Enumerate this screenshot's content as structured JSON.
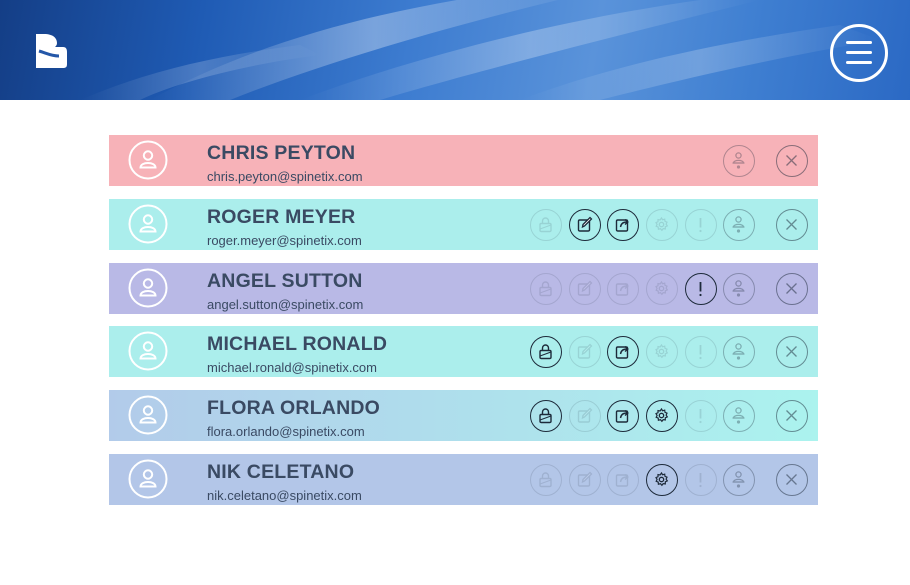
{
  "header": {
    "logo_icon": "company-logo",
    "menu_icon": "hamburger-menu-icon"
  },
  "users": [
    {
      "name": "CHRIS PEYTON",
      "email": "chris.peyton@spinetix.com",
      "bg": "#f7b2b8",
      "actions": {
        "lock": "hidden",
        "edit": "hidden",
        "share": "hidden",
        "settings": "hidden",
        "alert": "hidden",
        "profile": "dim",
        "close": "on"
      }
    },
    {
      "name": "ROGER MEYER",
      "email": "roger.meyer@spinetix.com",
      "bg": "#abeeec",
      "actions": {
        "lock": "off",
        "edit": "on",
        "share": "on",
        "settings": "off",
        "alert": "off",
        "profile": "dim",
        "close": "on"
      }
    },
    {
      "name": "ANGEL SUTTON",
      "email": "angel.sutton@spinetix.com",
      "bg": "#b9b9e6",
      "actions": {
        "lock": "off",
        "edit": "off",
        "share": "off",
        "settings": "off",
        "alert": "on",
        "profile": "dim",
        "close": "on"
      }
    },
    {
      "name": "MICHAEL RONALD",
      "email": "michael.ronald@spinetix.com",
      "bg": "#abeeec",
      "actions": {
        "lock": "on",
        "edit": "off",
        "share": "on",
        "settings": "off",
        "alert": "off",
        "profile": "dim",
        "close": "on"
      }
    },
    {
      "name": "FLORA ORLANDO",
      "email": "flora.orlando@spinetix.com",
      "bg_from": "#b2cbea",
      "bg_to": "#abf3ee",
      "actions": {
        "lock": "on",
        "edit": "off",
        "share": "on",
        "settings": "on",
        "alert": "off",
        "profile": "dim",
        "close": "on"
      }
    },
    {
      "name": "NIK CELETANO",
      "email": "nik.celetano@spinetix.com",
      "bg": "#b3c6e8",
      "actions": {
        "lock": "off",
        "edit": "off",
        "share": "off",
        "settings": "on",
        "alert": "off",
        "profile": "dim",
        "close": "on"
      }
    }
  ],
  "action_icons": [
    "lock-icon",
    "edit-icon",
    "share-icon",
    "settings-icon",
    "alert-icon",
    "profile-icon",
    "close-icon"
  ]
}
